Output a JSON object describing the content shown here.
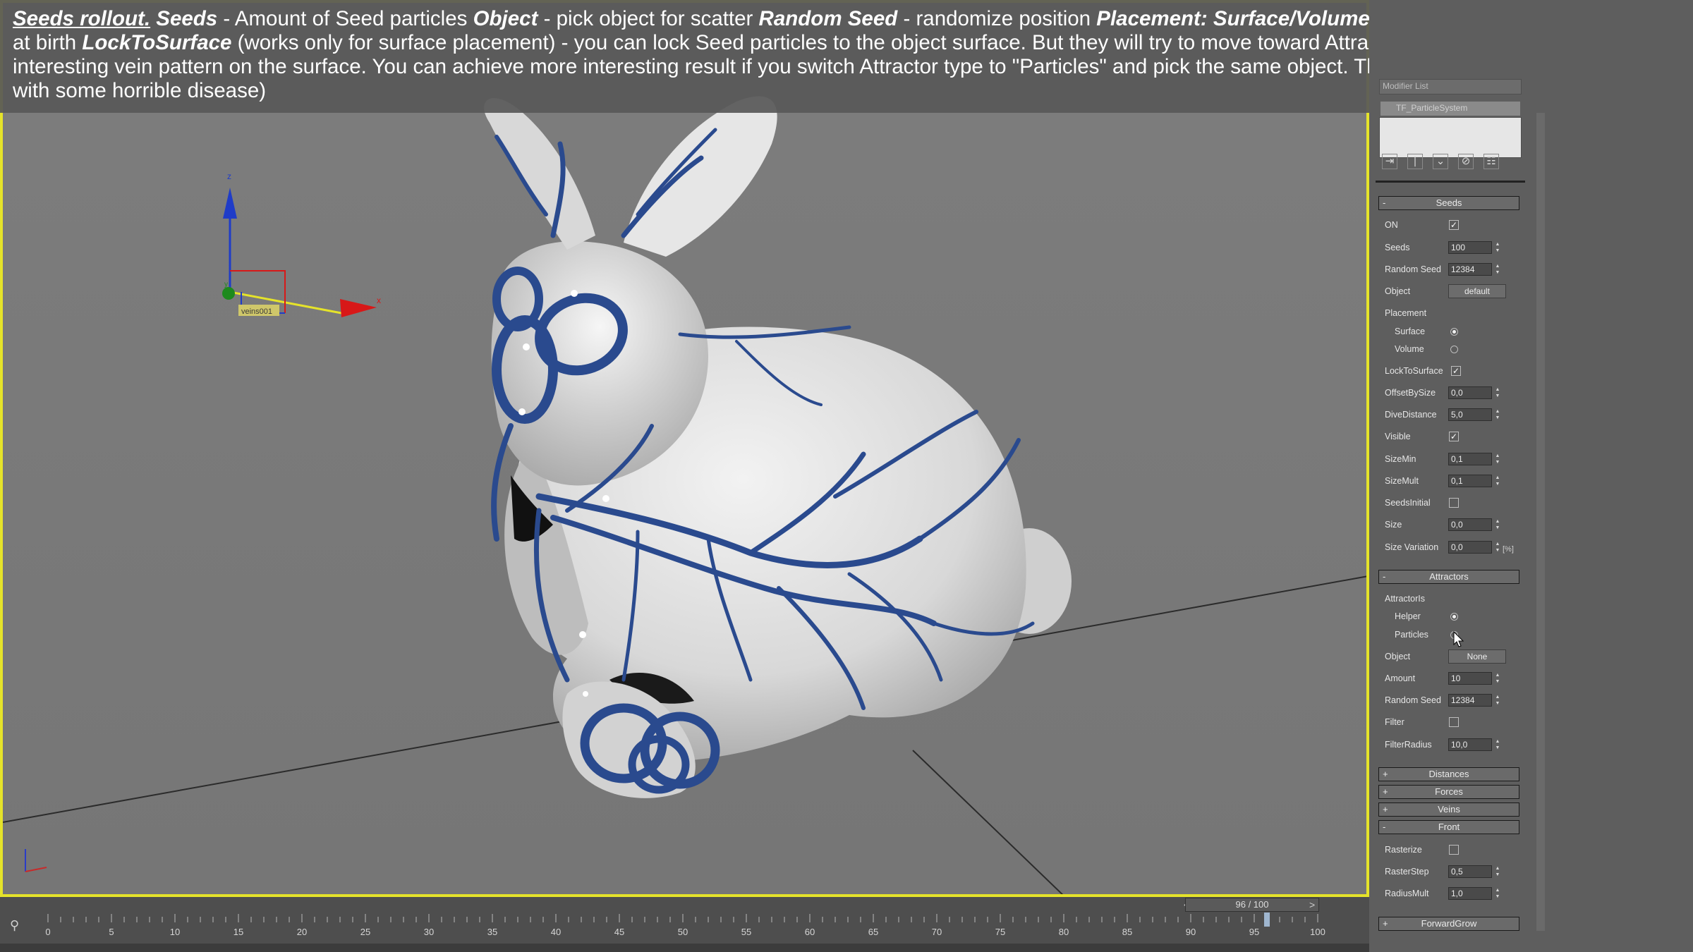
{
  "caption": {
    "rollout_title": "Seeds rollout.",
    "seeds_term": "Seeds",
    "seeds_desc": " - Amount of Seed particles ",
    "object_term": "Object",
    "object_desc": " - pick object for scatter  ",
    "random_term": "Random Seed",
    "random_desc": " - randomize position  ",
    "placement_term": "Placement: Surface/Volume",
    "placement_desc": " - placement of the Seed particles at birth ",
    "lock_term": "LockToSurface",
    "lock_desc": " (works only for surface placement) - you can lock Seed particles to the object surface. But they will try to move toward Attractor anyway and cause some interesting vein pattern on the surface. You can achieve more interesting result if you switch Attractor type to \"Particles\" and pick the same object. This poor bunny is definately sick with some horrible disease)"
  },
  "viewport": {
    "gizmo_label": "veins001",
    "axis_x": "x",
    "axis_y": "y",
    "axis_z": "z",
    "border_color": "#e5e32a",
    "vein_color": "#2a4a8e"
  },
  "modifier_stack": {
    "dropdown": "Modifier List",
    "item": "TF_ParticleSystem"
  },
  "seeds": {
    "title": "Seeds",
    "on_label": "ON",
    "on_checked": true,
    "seeds_label": "Seeds",
    "seeds_value": "100",
    "random_seed_label": "Random Seed",
    "random_seed_value": "12384",
    "object_label": "Object",
    "object_value": "default",
    "placement_label": "Placement",
    "surface_label": "Surface",
    "surface_selected": true,
    "volume_label": "Volume",
    "lock_label": "LockToSurface",
    "lock_checked": true,
    "offset_label": "OffsetBySize",
    "offset_value": "0,0",
    "dive_label": "DiveDistance",
    "dive_value": "5,0",
    "visible_label": "Visible",
    "visible_checked": true,
    "sizemin_label": "SizeMin",
    "sizemin_value": "0,1",
    "sizemult_label": "SizeMult",
    "sizemult_value": "0,1",
    "seedsinitial_label": "SeedsInitial",
    "size_label": "Size",
    "size_value": "0,0",
    "sizevar_label": "Size Variation",
    "sizevar_value": "0,0",
    "sizevar_unit": "[%]"
  },
  "attractors": {
    "title": "Attractors",
    "attractor_is_label": "AttractorIs",
    "helper_label": "Helper",
    "helper_selected": true,
    "particles_label": "Particles",
    "object_label": "Object",
    "object_value": "None",
    "amount_label": "Amount",
    "amount_value": "10",
    "random_seed_label": "Random Seed",
    "random_seed_value": "12384",
    "filter_label": "Filter",
    "filterradius_label": "FilterRadius",
    "filterradius_value": "10,0"
  },
  "collapsed_rollouts": [
    "Distances",
    "Forces",
    "Veins"
  ],
  "front": {
    "title": "Front",
    "rasterize_label": "Rasterize",
    "rasterstep_label": "RasterStep",
    "rasterstep_value": "0,5",
    "radiusmult_label": "RadiusMult",
    "radiusmult_value": "1,0"
  },
  "forwardgrow": {
    "title": "ForwardGrow"
  },
  "timeline": {
    "frame_label": "96 / 100",
    "current_frame": 96,
    "max_frame": 100,
    "ticks": [
      "0",
      "5",
      "10",
      "15",
      "20",
      "25",
      "30",
      "35",
      "40",
      "45",
      "50",
      "55",
      "60",
      "65",
      "70",
      "75",
      "80",
      "85",
      "90",
      "95",
      "100"
    ]
  }
}
